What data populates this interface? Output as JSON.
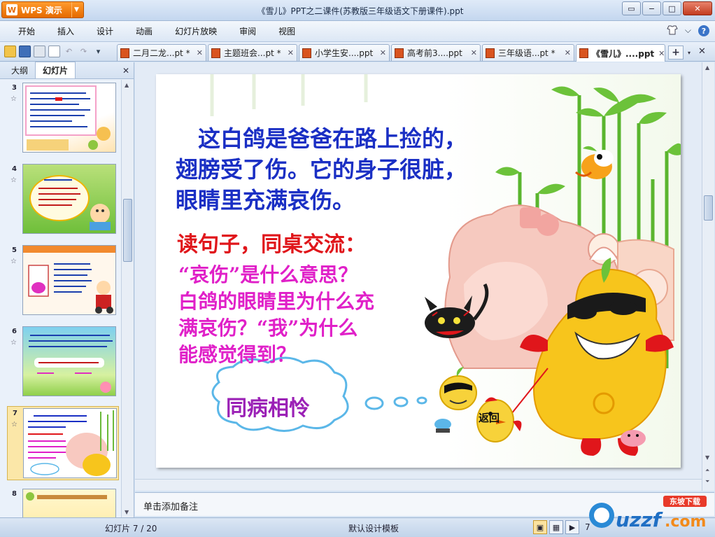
{
  "app": {
    "name": "WPS 演示",
    "logo_letter": "W",
    "window_title": "《雪儿》PPT之二课件(苏教版三年级语文下册课件).ppt",
    "window_controls": [
      "▭",
      "−",
      "□",
      "✕"
    ]
  },
  "menu": {
    "items": [
      "开始",
      "插入",
      "设计",
      "动画",
      "幻灯片放映",
      "审阅",
      "视图"
    ],
    "right_icons": [
      "skin-icon",
      "help-icon"
    ],
    "right_glyphs": [
      "⌵",
      "?"
    ]
  },
  "quick_access": [
    "open-icon",
    "save-icon",
    "print-icon",
    "preview-icon",
    "undo-icon",
    "redo-icon"
  ],
  "quick_access_glyphs": [
    "",
    "",
    "",
    "",
    "↶",
    "↷",
    "▾"
  ],
  "doc_tabs": [
    {
      "label": "二月二龙...pt *",
      "close": "✕"
    },
    {
      "label": "主题班会...pt *",
      "close": "✕"
    },
    {
      "label": "小学生安....ppt",
      "close": "✕"
    },
    {
      "label": "高考前3....ppt",
      "close": "✕"
    },
    {
      "label": "三年级语...pt *",
      "close": "✕"
    },
    {
      "label": "《雪儿》....ppt",
      "close": "✕"
    }
  ],
  "tab_controls": {
    "add": "+",
    "menu": "▾",
    "close": "✕"
  },
  "left_panel": {
    "tabs": [
      "大纲",
      "幻灯片"
    ],
    "active_tab": "幻灯片",
    "close": "✕",
    "thumbnails": [
      {
        "number": "3",
        "star": "☆"
      },
      {
        "number": "4",
        "star": "☆"
      },
      {
        "number": "5",
        "star": "☆"
      },
      {
        "number": "6",
        "star": "☆"
      },
      {
        "number": "7",
        "star": "☆",
        "selected": true
      },
      {
        "number": "8",
        "star": ""
      }
    ]
  },
  "slide": {
    "main_text": [
      "　这白鸽是爸爸在路上捡的，",
      "翅膀受了伤。它的身子很脏，",
      "眼睛里充满哀伤。"
    ],
    "instruction": "读句子，同桌交流：",
    "questions": [
      "“哀伤”是什么意思？",
      "白鸽的眼睛里为什么充",
      "满哀伤？“我”为什么",
      "能感觉得到？"
    ],
    "cloud_label": "同病相怜",
    "return_label": "返回",
    "colors": {
      "main": "#1a2fc4",
      "instruction": "#e0161b",
      "questions": "#e020c8",
      "cloud_text": "#9b21b6"
    }
  },
  "notes": {
    "placeholder": "单击添加备注"
  },
  "status": {
    "slide_indicator": "幻灯片 7 / 20",
    "template": "默认设计模板",
    "zoom": "7",
    "view_icons": [
      "normal-view-icon",
      "slide-sorter-icon",
      "slideshow-icon"
    ],
    "view_glyphs": [
      "▣",
      "▦",
      "▶"
    ]
  },
  "watermark": {
    "text": "uzzf.com",
    "sub": "东坡下载"
  }
}
